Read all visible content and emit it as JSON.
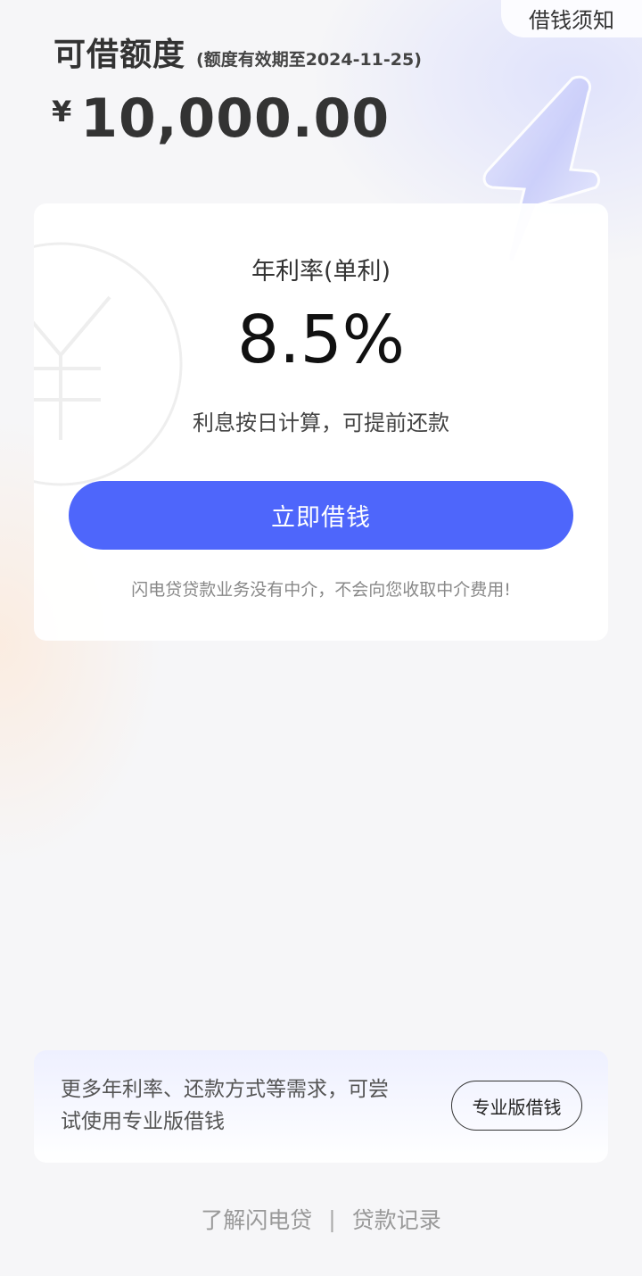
{
  "header": {
    "notice_link": "借钱须知",
    "quota_title": "可借额度",
    "quota_validity": "(额度有效期至2024-11-25)",
    "currency_symbol": "¥",
    "amount": "10,000.00"
  },
  "rate_card": {
    "rate_label": "年利率(单利)",
    "rate_value": "8.5%",
    "rate_note": "利息按日计算，可提前还款",
    "borrow_button": "立即借钱",
    "disclaimer": "闪电贷贷款业务没有中介，不会向您收取中介费用!"
  },
  "promo": {
    "text": "更多年利率、还款方式等需求，可尝试使用专业版借钱",
    "button": "专业版借钱"
  },
  "footer": {
    "link_about": "了解闪电贷",
    "separator": "|",
    "link_records": "贷款记录"
  },
  "colors": {
    "accent": "#4e66fb",
    "background": "#f6f6f8"
  },
  "icons": {
    "decoration": "lightning-bolt-icon",
    "watermark": "yuan-coin-icon"
  }
}
